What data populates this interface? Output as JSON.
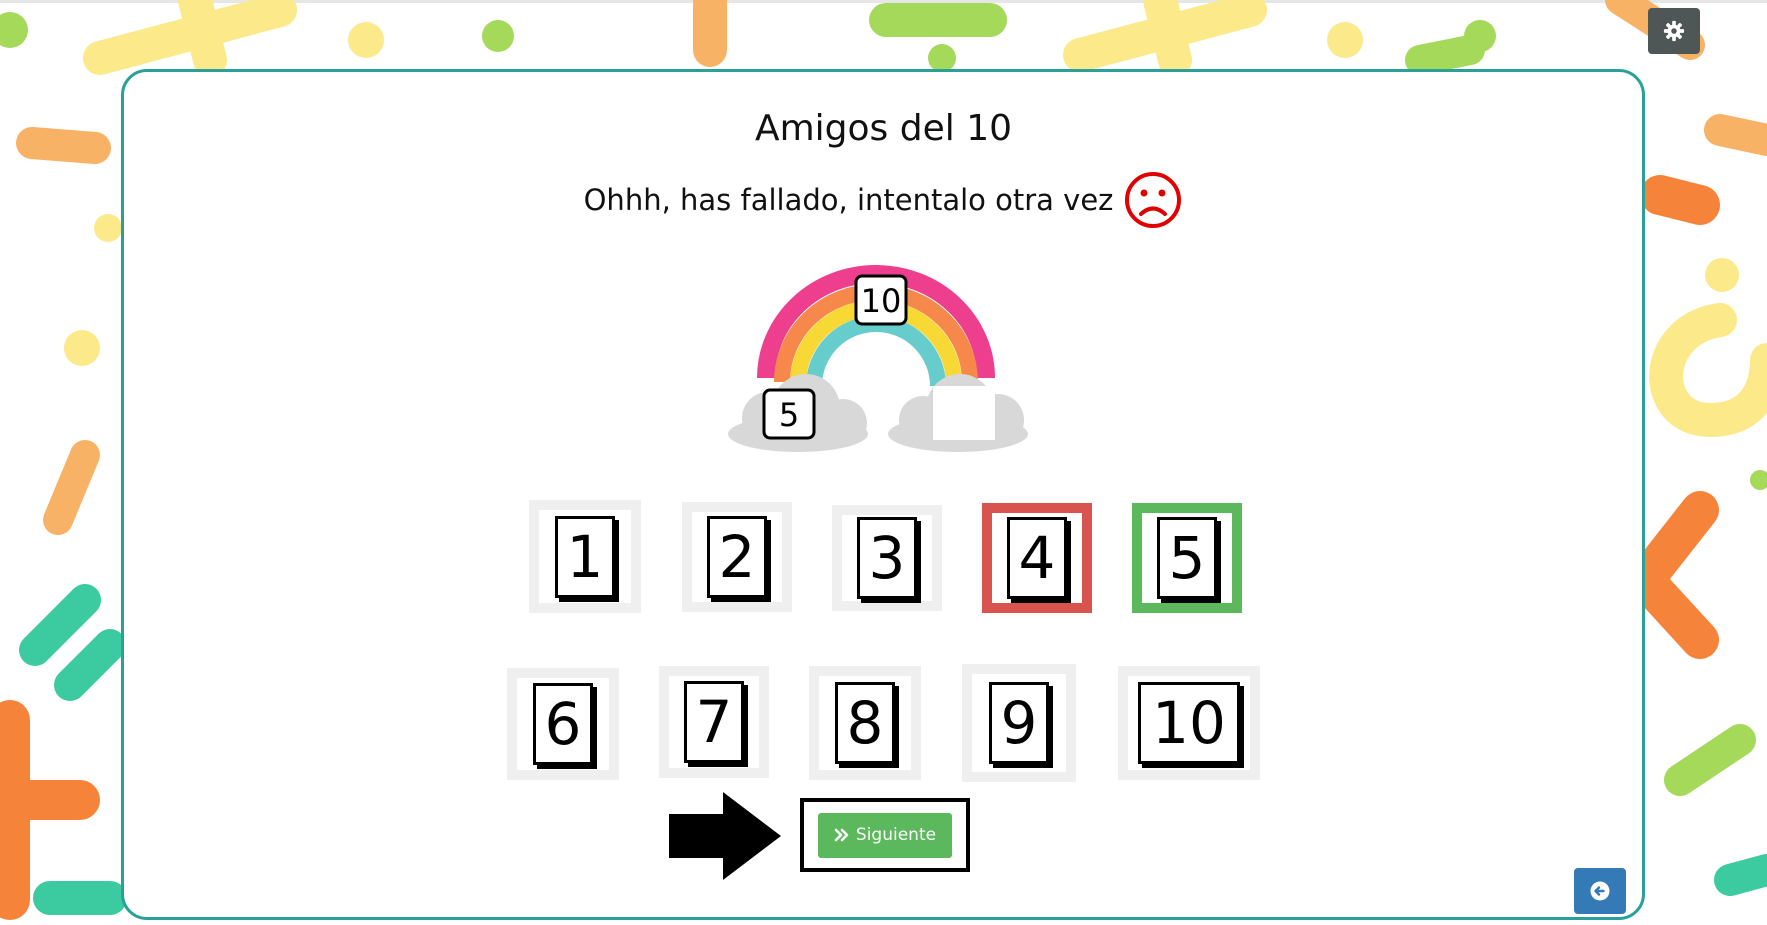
{
  "page": {
    "title": "Amigos del 10",
    "message": "Ohhh, has fallado, intentalo otra vez"
  },
  "rainbow": {
    "top_number": "10",
    "left_number": "5",
    "right_number": ""
  },
  "options": [
    {
      "label": "1",
      "state": "normal"
    },
    {
      "label": "2",
      "state": "normal"
    },
    {
      "label": "3",
      "state": "normal"
    },
    {
      "label": "4",
      "state": "wrong"
    },
    {
      "label": "5",
      "state": "correct"
    },
    {
      "label": "6",
      "state": "normal"
    },
    {
      "label": "7",
      "state": "normal"
    },
    {
      "label": "8",
      "state": "normal"
    },
    {
      "label": "9",
      "state": "normal"
    },
    {
      "label": "10",
      "state": "normal"
    }
  ],
  "next_button": {
    "icon": "double-chevron-right-icon",
    "label": "Siguiente"
  },
  "colors": {
    "card_border": "#2aa198",
    "wrong": "#d9534f",
    "correct": "#5cb85c",
    "settings": "#4f5656",
    "back": "#337ab7",
    "sad_face": "#e00000"
  },
  "icons": {
    "settings": "gear-icon",
    "back": "arrow-circle-left-icon",
    "feedback": "sad-face-icon",
    "pointer": "black-arrow-right-icon"
  }
}
